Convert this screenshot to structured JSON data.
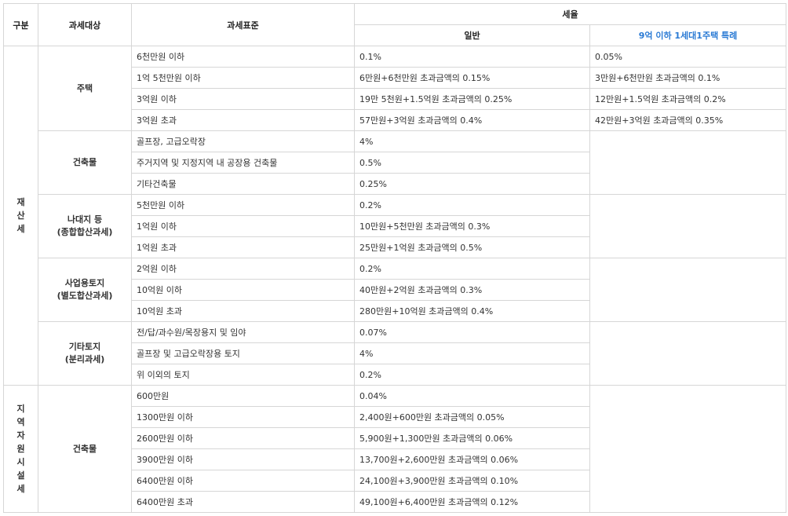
{
  "headers": {
    "category": "구분",
    "target": "과세대상",
    "standard": "과세표준",
    "rate": "세율",
    "general": "일반",
    "special": "9억 이하 1세대1주택 특례"
  },
  "accent_color": "#2a7ad4",
  "groups": [
    {
      "label": "재산세",
      "subgroups": [
        {
          "label_lines": [
            "주택"
          ],
          "rows": [
            {
              "standard": "6천만원 이하",
              "general": "0.1%",
              "special": "0.05%"
            },
            {
              "standard": "1억 5천만원 이하",
              "general": "6만원+6천만원 초과금액의 0.15%",
              "special": "3만원+6천만원 초과금액의 0.1%"
            },
            {
              "standard": "3억원 이하",
              "general": "19만 5천원+1.5억원 초과금액의 0.25%",
              "special": "12만원+1.5억원 초과금액의 0.2%"
            },
            {
              "standard": "3억원 초과",
              "general": "57만원+3억원 초과금액의 0.4%",
              "special": "42만원+3억원 초과금액의 0.35%"
            }
          ]
        },
        {
          "label_lines": [
            "건축물"
          ],
          "rows": [
            {
              "standard": "골프장, 고급오락장",
              "general": "4%",
              "special": ""
            },
            {
              "standard": "주거지역 및 지정지역 내 공장용 건축물",
              "general": "0.5%",
              "special": ""
            },
            {
              "standard": "기타건축물",
              "general": "0.25%",
              "special": ""
            }
          ]
        },
        {
          "label_lines": [
            "나대지 등",
            "(종합합산과세)"
          ],
          "rows": [
            {
              "standard": "5천만원 이하",
              "general": "0.2%",
              "special": ""
            },
            {
              "standard": "1억원 이하",
              "general": "10만원+5천만원 초과금액의 0.3%",
              "special": ""
            },
            {
              "standard": "1억원 초과",
              "general": "25만원+1억원 초과금액의 0.5%",
              "special": ""
            }
          ]
        },
        {
          "label_lines": [
            "사업용토지",
            "(별도합산과세)"
          ],
          "rows": [
            {
              "standard": "2억원 이하",
              "general": "0.2%",
              "special": ""
            },
            {
              "standard": "10억원 이하",
              "general": "40만원+2억원 초과금액의 0.3%",
              "special": ""
            },
            {
              "standard": "10억원 초과",
              "general": "280만원+10억원 초과금액의 0.4%",
              "special": ""
            }
          ]
        },
        {
          "label_lines": [
            "기타토지",
            "(분리과세)"
          ],
          "rows": [
            {
              "standard": "전/답/과수원/목장용지 및 임야",
              "general": "0.07%",
              "special": ""
            },
            {
              "standard": "골프장 및 고급오락장용 토지",
              "general": "4%",
              "special": ""
            },
            {
              "standard": "위 이외의 토지",
              "general": "0.2%",
              "special": ""
            }
          ]
        }
      ]
    },
    {
      "label": "지역자원시설세",
      "subgroups": [
        {
          "label_lines": [
            "건축물"
          ],
          "rows": [
            {
              "standard": "600만원",
              "general": "0.04%",
              "special": null
            },
            {
              "standard": "1300만원 이하",
              "general": "2,400원+600만원 초과금액의 0.05%",
              "special": null
            },
            {
              "standard": "2600만원 이하",
              "general": "5,900원+1,300만원 초과금액의 0.06%",
              "special": null
            },
            {
              "standard": "3900만원 이하",
              "general": "13,700원+2,600만원 초과금액의 0.06%",
              "special": null
            },
            {
              "standard": "6400만원 이하",
              "general": "24,100원+3,900만원 초과금액의 0.10%",
              "special": null
            },
            {
              "standard": "6400만원 초과",
              "general": "49,100원+6,400만원 초과금액의 0.12%",
              "special": null
            }
          ]
        }
      ]
    }
  ]
}
